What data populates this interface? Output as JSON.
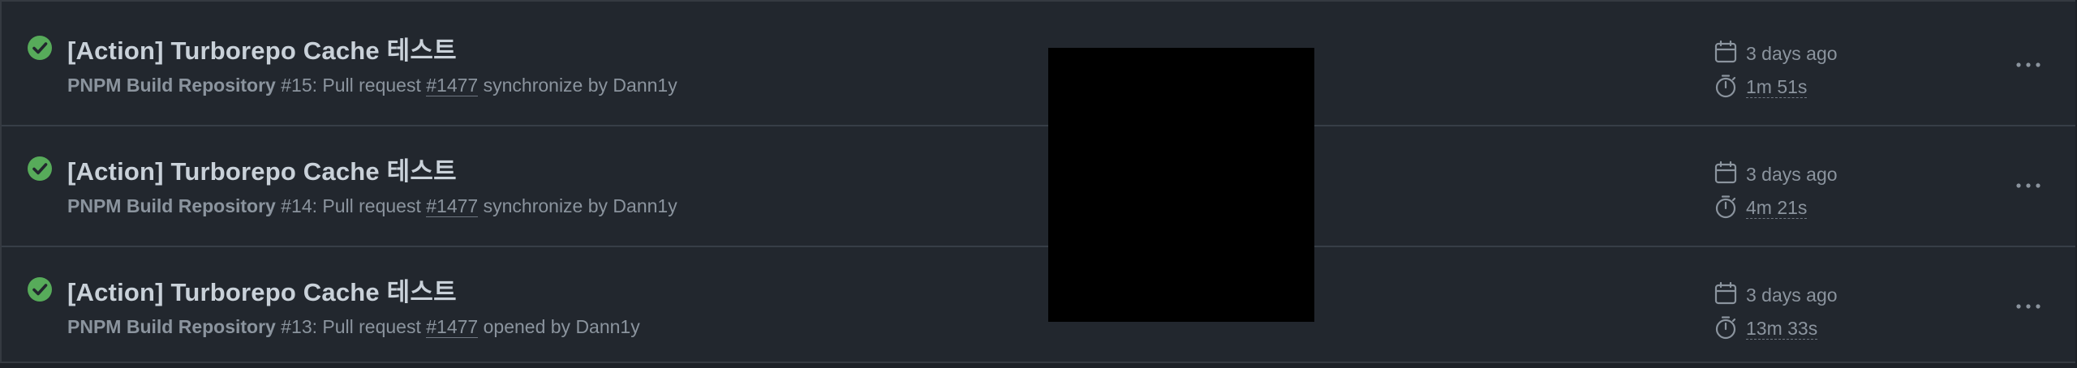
{
  "colors": {
    "background": "#22272e",
    "success": "#57ab5a",
    "title_text": "#c9d1d9",
    "muted_text": "#8b949e"
  },
  "runs": [
    {
      "status": "success",
      "status_icon": "check-circle-icon",
      "title": "[Action] Turborepo Cache 테스트",
      "workflow": "PNPM Build Repository",
      "run_number": "#15",
      "event_prefix": ": Pull request ",
      "pr_link": "#1477",
      "event_suffix": " synchronize by Dann1y",
      "date_icon": "calendar-icon",
      "date": "3 days ago",
      "duration_icon": "stopwatch-icon",
      "duration": "1m 51s",
      "menu_icon": "kebab-horizontal-icon"
    },
    {
      "status": "success",
      "status_icon": "check-circle-icon",
      "title": "[Action] Turborepo Cache 테스트",
      "workflow": "PNPM Build Repository",
      "run_number": "#14",
      "event_prefix": ": Pull request ",
      "pr_link": "#1477",
      "event_suffix": " synchronize by Dann1y",
      "date_icon": "calendar-icon",
      "date": "3 days ago",
      "duration_icon": "stopwatch-icon",
      "duration": "4m 21s",
      "menu_icon": "kebab-horizontal-icon"
    },
    {
      "status": "success",
      "status_icon": "check-circle-icon",
      "title": "[Action] Turborepo Cache 테스트",
      "workflow": "PNPM Build Repository",
      "run_number": "#13",
      "event_prefix": ": Pull request ",
      "pr_link": "#1477",
      "event_suffix": " opened by Dann1y",
      "date_icon": "calendar-icon",
      "date": "3 days ago",
      "duration_icon": "stopwatch-icon",
      "duration": "13m 33s",
      "menu_icon": "kebab-horizontal-icon"
    }
  ]
}
